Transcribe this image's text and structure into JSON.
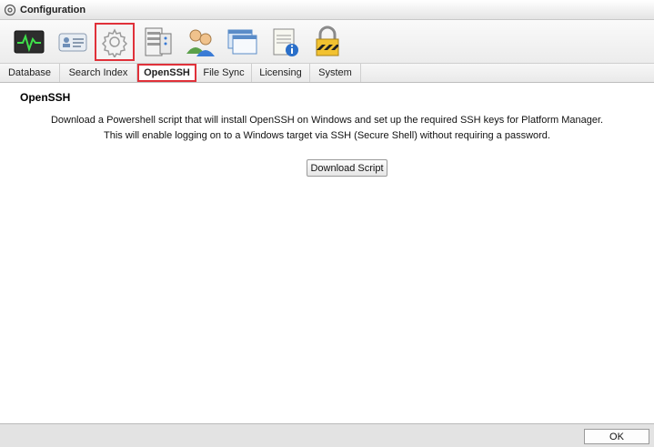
{
  "window": {
    "title": "Configuration"
  },
  "toolbar": {
    "buttons": [
      {
        "icon": "monitor-icon"
      },
      {
        "icon": "id-card-icon"
      },
      {
        "icon": "gear-icon",
        "selected": true
      },
      {
        "icon": "server-icon"
      },
      {
        "icon": "users-icon"
      },
      {
        "icon": "window-icon"
      },
      {
        "icon": "notepad-info-icon"
      },
      {
        "icon": "padlock-icon"
      }
    ]
  },
  "tabs": [
    {
      "label": "Database"
    },
    {
      "label": "Search Index"
    },
    {
      "label": "OpenSSH",
      "active": true
    },
    {
      "label": "File Sync"
    },
    {
      "label": "Licensing"
    },
    {
      "label": "System"
    }
  ],
  "content": {
    "heading": "OpenSSH",
    "line1": "Download a Powershell script that will install OpenSSH on Windows and set up the required SSH keys for Platform Manager.",
    "line2": "This will enable logging on to a Windows target via SSH (Secure Shell) without requiring a password.",
    "download_label": "Download Script"
  },
  "footer": {
    "ok_label": "OK"
  },
  "colors": {
    "selection": "#e0313a"
  }
}
